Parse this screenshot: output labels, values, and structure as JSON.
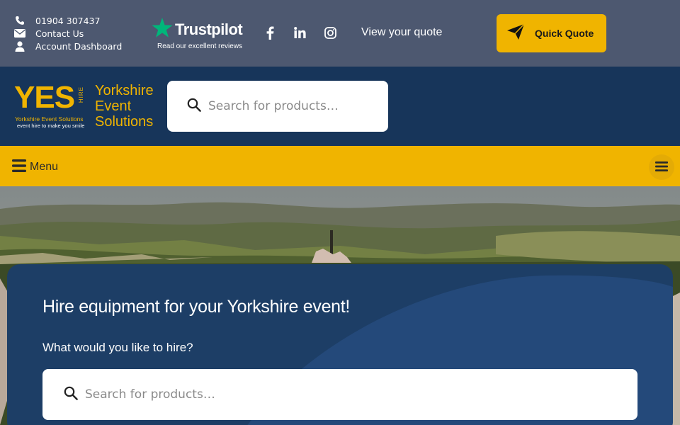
{
  "topbar": {
    "phone": "01904 307437",
    "contact": "Contact Us",
    "account": "Account Dashboard",
    "trustpilot_word": "Trustpilot",
    "trustpilot_sub": "Read our excellent reviews",
    "view_quote": "View your quote",
    "quick_quote": "Quick Quote",
    "icons": [
      "phone-icon",
      "envelope-icon",
      "user-icon",
      "facebook-icon",
      "linkedin-icon",
      "instagram-icon",
      "paper-plane-icon"
    ]
  },
  "header": {
    "logo": {
      "mark": "YES",
      "hire": "HIRE",
      "small1": "Yorkshire Event Solutions",
      "small2": "event hire to make you smile",
      "name_lines": [
        "Yorkshire",
        "Event",
        "Solutions"
      ]
    },
    "search_placeholder": "Search for products…"
  },
  "menubar": {
    "menu_label": "Menu"
  },
  "hero": {
    "title": "Hire equipment for your Yorkshire event!",
    "subtitle": "What would you like to hire?",
    "search_placeholder": "Search for products…"
  },
  "colors": {
    "topbar": "#4d5870",
    "header": "#17355a",
    "accent": "#f0b400",
    "panel": "#1d3e66",
    "trustpilot_star": "#00b67a"
  }
}
